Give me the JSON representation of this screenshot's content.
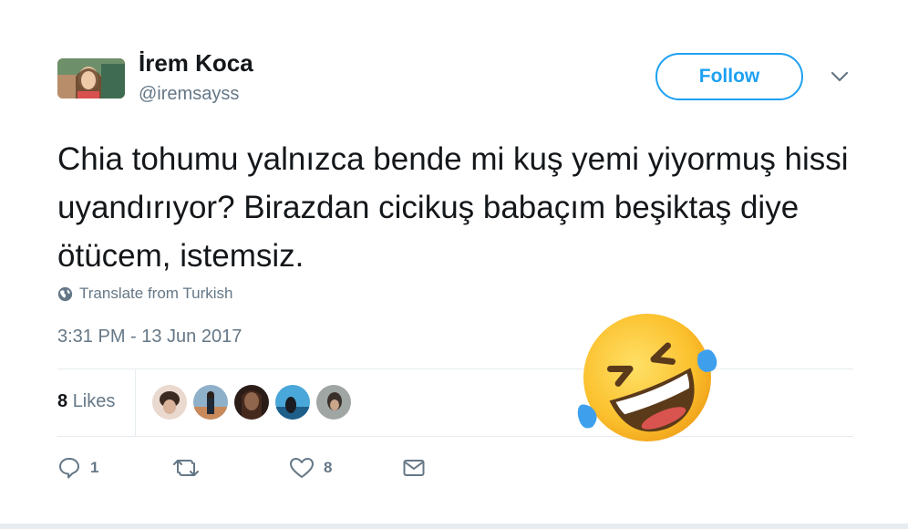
{
  "author": {
    "name": "İrem Koca",
    "handle": "@iremsayss"
  },
  "follow_label": "Follow",
  "tweet_text": "Chia tohumu yalnızca bende mi kuş yemi yiyormuş hissi uyandırıyor? Birazdan cicikuş babaçım beşiktaş diye ötücem, istemsiz.",
  "translate_label": "Translate from Turkish",
  "timestamp": "3:31 PM - 13 Jun 2017",
  "likes": {
    "count": "8",
    "label": "Likes"
  },
  "actions": {
    "reply_count": "1",
    "retweet_count": "",
    "like_count": "8"
  },
  "colors": {
    "accent": "#1da1f2",
    "secondary_text": "#657786",
    "primary_text": "#14171a"
  },
  "icons": [
    "globe-icon",
    "chevron-down-icon",
    "reply-icon",
    "retweet-icon",
    "heart-icon",
    "mail-icon",
    "rofl-emoji-icon"
  ]
}
